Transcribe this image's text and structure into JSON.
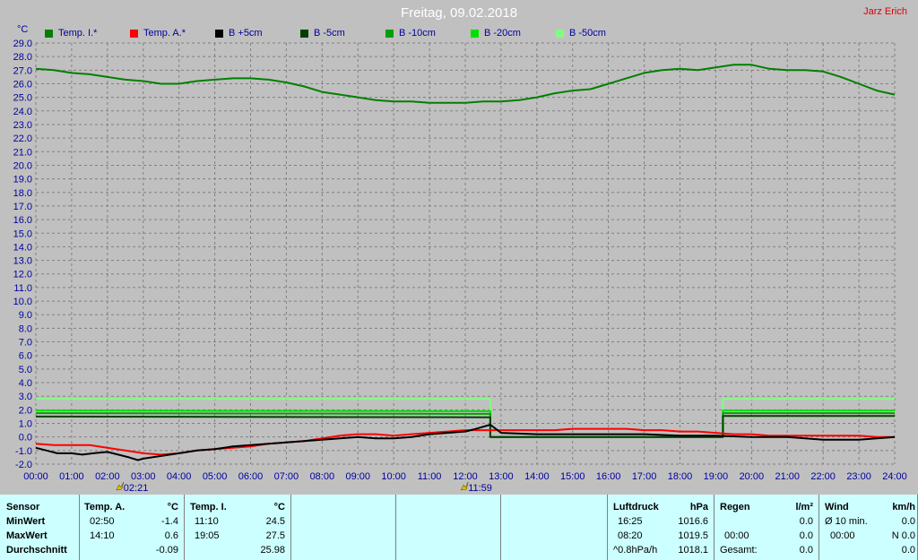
{
  "title": "Freitag, 09.02.2018",
  "author": "Jarz Erich",
  "unit": "°C",
  "legend": [
    {
      "label": "Temp. I.*",
      "color": "#008000"
    },
    {
      "label": "Temp. A.*",
      "color": "#ff0000"
    },
    {
      "label": "B +5cm",
      "color": "#000000"
    },
    {
      "label": "B -5cm",
      "color": "#004000"
    },
    {
      "label": "B -10cm",
      "color": "#00a000"
    },
    {
      "label": "B -20cm",
      "color": "#00e000"
    },
    {
      "label": "B -50cm",
      "color": "#80ff80"
    }
  ],
  "markers": [
    {
      "label": "02:21",
      "x": 2.35
    },
    {
      "label": "11:59",
      "x": 11.98
    }
  ],
  "chart_data": {
    "type": "line",
    "title": "Freitag, 09.02.2018",
    "ylabel": "°C",
    "xlim": [
      0,
      24
    ],
    "ylim": [
      -2,
      29
    ],
    "grid": true,
    "x_ticks": [
      "00:00",
      "01:00",
      "02:00",
      "03:00",
      "04:00",
      "05:00",
      "06:00",
      "07:00",
      "08:00",
      "09:00",
      "10:00",
      "11:00",
      "12:00",
      "13:00",
      "14:00",
      "15:00",
      "16:00",
      "17:00",
      "18:00",
      "19:00",
      "20:00",
      "21:00",
      "22:00",
      "23:00",
      "24:00"
    ],
    "y_ticks": [
      "-2.0",
      "-1.0",
      "0.0",
      "1.0",
      "2.0",
      "3.0",
      "4.0",
      "5.0",
      "6.0",
      "7.0",
      "8.0",
      "9.0",
      "10.0",
      "11.0",
      "12.0",
      "13.0",
      "14.0",
      "15.0",
      "16.0",
      "17.0",
      "18.0",
      "19.0",
      "20.0",
      "21.0",
      "22.0",
      "23.0",
      "24.0",
      "25.0",
      "26.0",
      "27.0",
      "28.0",
      "29.0"
    ],
    "series": [
      {
        "name": "B -50cm",
        "color": "#80ff80",
        "x": [
          0,
          12.7,
          12.7,
          19.2,
          19.2,
          24
        ],
        "y": [
          2.8,
          2.8,
          0.0,
          0.0,
          2.8,
          2.8
        ]
      },
      {
        "name": "B -20cm",
        "color": "#00e000",
        "x": [
          0,
          12.7,
          12.7,
          19.2,
          19.2,
          24
        ],
        "y": [
          1.95,
          1.9,
          0.0,
          0.0,
          1.95,
          1.95
        ]
      },
      {
        "name": "B -10cm",
        "color": "#00a000",
        "x": [
          0,
          12.7,
          12.7,
          19.2,
          19.2,
          24
        ],
        "y": [
          1.75,
          1.7,
          0.0,
          0.0,
          1.75,
          1.75
        ]
      },
      {
        "name": "B -5cm",
        "color": "#004000",
        "x": [
          0,
          12.7,
          12.7,
          19.2,
          19.2,
          24
        ],
        "y": [
          1.5,
          1.45,
          0.0,
          0.0,
          1.55,
          1.55
        ]
      },
      {
        "name": "Temp. I.*",
        "color": "#008000",
        "x": [
          0,
          0.5,
          1,
          1.5,
          2,
          2.5,
          3,
          3.5,
          4,
          4.5,
          5,
          5.5,
          6,
          6.5,
          7,
          7.5,
          8,
          8.5,
          9,
          9.5,
          10,
          10.5,
          11,
          11.5,
          12,
          12.5,
          13,
          13.5,
          14,
          14.5,
          15,
          15.5,
          16,
          16.5,
          17,
          17.5,
          18,
          18.5,
          19,
          19.5,
          20,
          20.5,
          21,
          21.5,
          22,
          22.5,
          23,
          23.5,
          24
        ],
        "y": [
          27.1,
          27.0,
          26.8,
          26.7,
          26.5,
          26.3,
          26.2,
          26.0,
          26.0,
          26.2,
          26.3,
          26.4,
          26.4,
          26.3,
          26.1,
          25.8,
          25.4,
          25.2,
          25.0,
          24.8,
          24.7,
          24.7,
          24.6,
          24.6,
          24.6,
          24.7,
          24.7,
          24.8,
          25.0,
          25.3,
          25.5,
          25.6,
          26.0,
          26.4,
          26.8,
          27.0,
          27.1,
          27.0,
          27.2,
          27.4,
          27.4,
          27.1,
          27.0,
          27.0,
          26.9,
          26.5,
          26.0,
          25.5,
          25.2
        ]
      },
      {
        "name": "Temp. A.*",
        "color": "#ff0000",
        "x": [
          0,
          0.5,
          1,
          1.5,
          2,
          2.5,
          3,
          3.5,
          4,
          4.5,
          5,
          5.5,
          6,
          6.5,
          7,
          7.5,
          8,
          8.5,
          9,
          9.5,
          10,
          10.5,
          11,
          11.5,
          12,
          12.5,
          13,
          13.5,
          14,
          14.5,
          15,
          15.5,
          16,
          16.5,
          17,
          17.5,
          18,
          18.5,
          19,
          19.5,
          20,
          20.5,
          21,
          21.5,
          22,
          22.5,
          23,
          23.5,
          24
        ],
        "y": [
          -0.5,
          -0.6,
          -0.6,
          -0.6,
          -0.8,
          -1.0,
          -1.2,
          -1.3,
          -1.2,
          -1.0,
          -0.9,
          -0.8,
          -0.7,
          -0.5,
          -0.4,
          -0.3,
          -0.1,
          0.1,
          0.2,
          0.2,
          0.1,
          0.2,
          0.3,
          0.4,
          0.5,
          0.5,
          0.5,
          0.5,
          0.5,
          0.5,
          0.6,
          0.6,
          0.6,
          0.6,
          0.5,
          0.5,
          0.4,
          0.4,
          0.3,
          0.2,
          0.2,
          0.1,
          0.1,
          0.1,
          0.1,
          0.1,
          0.1,
          0.0,
          0.0
        ]
      },
      {
        "name": "B +5cm",
        "color": "#000000",
        "x": [
          0,
          0.3,
          0.6,
          1,
          1.3,
          1.6,
          2,
          2.3,
          2.6,
          2.85,
          3,
          3.5,
          4,
          4.5,
          5,
          5.5,
          6,
          6.5,
          7,
          7.5,
          8,
          8.5,
          9,
          9.5,
          10,
          10.5,
          11,
          11.5,
          12,
          12.3,
          12.7,
          13,
          14,
          15,
          16,
          17,
          18,
          19,
          20,
          20.5,
          21,
          21.5,
          22,
          22.5,
          23,
          23.5,
          24
        ],
        "y": [
          -0.8,
          -1.0,
          -1.2,
          -1.2,
          -1.3,
          -1.2,
          -1.1,
          -1.3,
          -1.5,
          -1.7,
          -1.6,
          -1.4,
          -1.2,
          -1.0,
          -0.9,
          -0.7,
          -0.6,
          -0.5,
          -0.4,
          -0.3,
          -0.2,
          -0.1,
          0.0,
          -0.1,
          -0.1,
          0.0,
          0.2,
          0.3,
          0.4,
          0.6,
          0.9,
          0.3,
          0.2,
          0.2,
          0.2,
          0.2,
          0.1,
          0.1,
          0.0,
          0.0,
          0.0,
          -0.1,
          -0.2,
          -0.2,
          -0.2,
          -0.1,
          0.0
        ]
      }
    ]
  },
  "stats": {
    "sensor_header": "Sensor",
    "min_label": "MinWert",
    "max_label": "MaxWert",
    "avg_label": "Durchschnitt",
    "temp_a": {
      "header": "Temp. A.",
      "unit": "°C",
      "min_time": "02:50",
      "min_val": "-1.4",
      "max_time": "14:10",
      "max_val": "0.6",
      "avg": "-0.09"
    },
    "temp_i": {
      "header": "Temp. I.",
      "unit": "°C",
      "min_time": "11:10",
      "min_val": "24.5",
      "max_time": "19:05",
      "max_val": "27.5",
      "avg": "25.98"
    },
    "pressure": {
      "header": "Luftdruck",
      "unit": "hPa",
      "min_time": "16:25",
      "min_val": "1016.6",
      "max_time": "08:20",
      "max_val": "1019.5",
      "trend_label": "^0.8hPa/h",
      "trend_val": "1018.1"
    },
    "rain": {
      "header": "Regen",
      "unit": "l/m²",
      "row1_val": "0.0",
      "row2_label": "00:00",
      "row2_val": "0.0",
      "row3_label": "Gesamt:",
      "row3_val": "0.0"
    },
    "wind": {
      "header": "Wind",
      "unit": "km/h",
      "row1_label": "Ø 10 min.",
      "row1_val": "0.0",
      "row2_label": "00:00",
      "row2_val": "N 0.0",
      "row3_val": "0.0"
    }
  }
}
